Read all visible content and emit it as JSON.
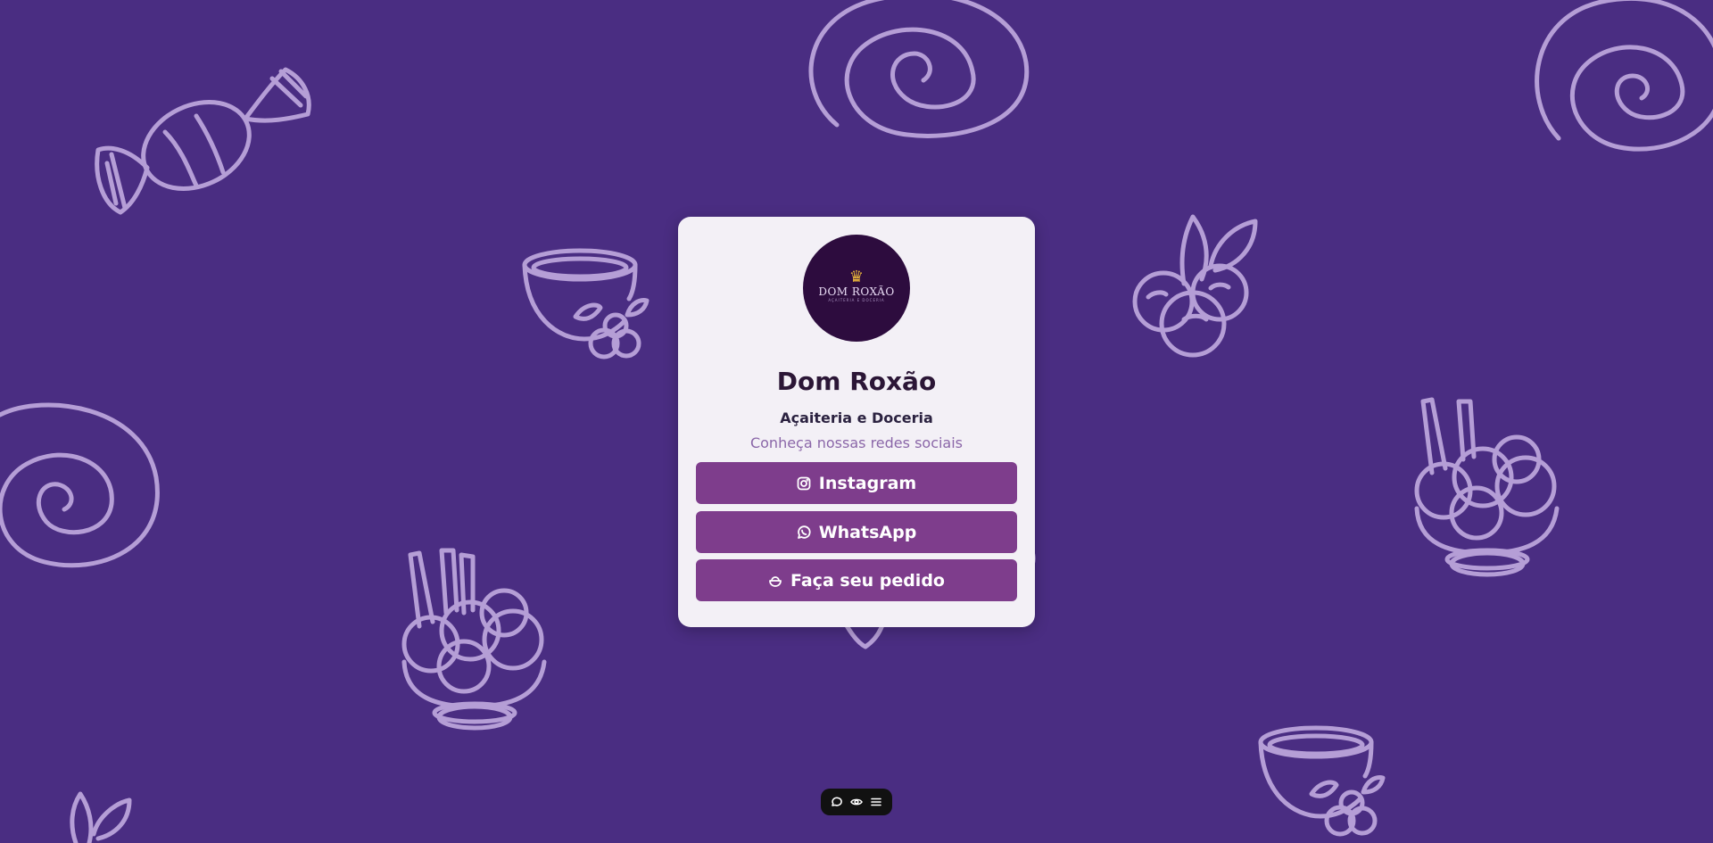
{
  "colors": {
    "background": "#4a2d82",
    "doodle": "#b59ed6",
    "card": "#f3f0f6",
    "button": "#7e3d8c",
    "title": "#2b1636",
    "tagline": "#8a66a8"
  },
  "profile": {
    "logo_text": "DOM ROXÃO",
    "logo_subtext": "AÇAITERIA E DOCERIA",
    "logo_icon": "crown-icon",
    "name": "Dom Roxão",
    "subtitle": "Açaiteria e Doceria",
    "tagline": "Conheça nossas redes sociais"
  },
  "links": [
    {
      "label": "Instagram",
      "icon": "instagram-icon"
    },
    {
      "label": "WhatsApp",
      "icon": "whatsapp-icon"
    },
    {
      "label": "Faça seu pedido",
      "icon": "ice-cream-bowl-icon"
    }
  ],
  "toolbar": {
    "items": [
      "chat-icon",
      "eye-icon",
      "menu-icon"
    ]
  }
}
